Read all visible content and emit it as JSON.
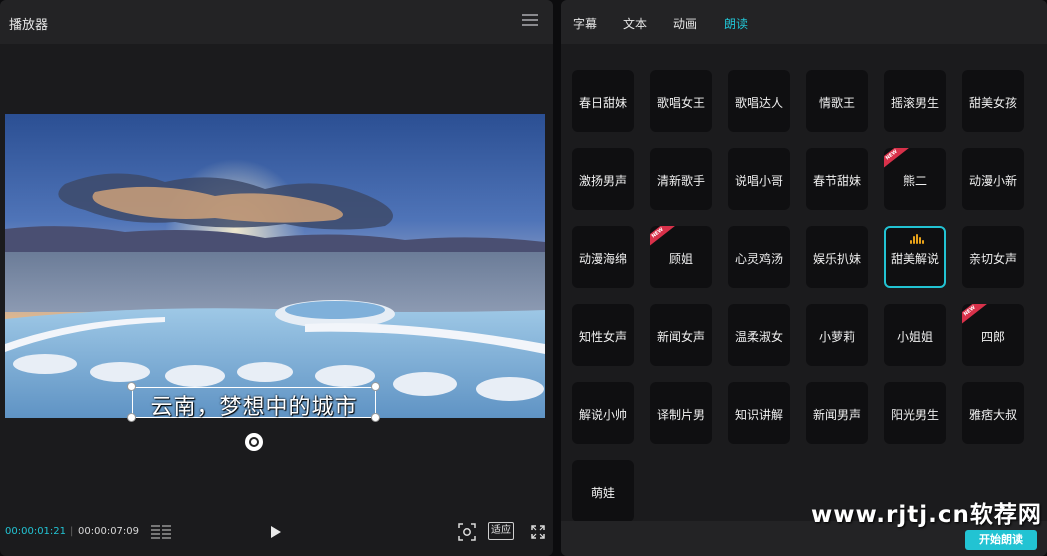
{
  "player": {
    "title": "播放器",
    "menu_icon": "hamburger-menu-icon",
    "caption": "云南，梦想中的城市",
    "time_current": "00:00:01:21",
    "time_separator": "|",
    "time_total": "00:00:07:09",
    "fit_label": "适应",
    "icons": {
      "grid": "grid-icon",
      "play": "play-icon",
      "screenshot": "screenshot-icon",
      "fullscreen": "fullscreen-icon",
      "rotate": "rotate-icon"
    }
  },
  "tabs": [
    "字幕",
    "文本",
    "动画",
    "朗读"
  ],
  "active_tab": "朗读",
  "voices": [
    {
      "label": "春日甜妹"
    },
    {
      "label": "歌唱女王"
    },
    {
      "label": "歌唱达人"
    },
    {
      "label": "情歌王"
    },
    {
      "label": "摇滚男生"
    },
    {
      "label": "甜美女孩"
    },
    {
      "label": "激扬男声"
    },
    {
      "label": "清新歌手"
    },
    {
      "label": "说唱小哥"
    },
    {
      "label": "春节甜妹"
    },
    {
      "label": "熊二",
      "badge": "NEW"
    },
    {
      "label": "动漫小新"
    },
    {
      "label": "动漫海绵"
    },
    {
      "label": "顾姐",
      "badge": "NEW"
    },
    {
      "label": "心灵鸡汤"
    },
    {
      "label": "娱乐扒妹"
    },
    {
      "label": "甜美解说",
      "selected": true
    },
    {
      "label": "亲切女声"
    },
    {
      "label": "知性女声"
    },
    {
      "label": "新闻女声"
    },
    {
      "label": "温柔淑女"
    },
    {
      "label": "小萝莉"
    },
    {
      "label": "小姐姐"
    },
    {
      "label": "四郎",
      "badge": "NEW"
    },
    {
      "label": "解说小帅"
    },
    {
      "label": "译制片男"
    },
    {
      "label": "知识讲解"
    },
    {
      "label": "新闻男声"
    },
    {
      "label": "阳光男生"
    },
    {
      "label": "雅痞大叔"
    },
    {
      "label": "萌娃"
    }
  ],
  "start_button": "开始朗读",
  "watermark": "www.rjtj.cn软荐网",
  "colors": {
    "accent": "#22c3d3",
    "badge": "#d8314a",
    "wave": "#e8a21a"
  }
}
